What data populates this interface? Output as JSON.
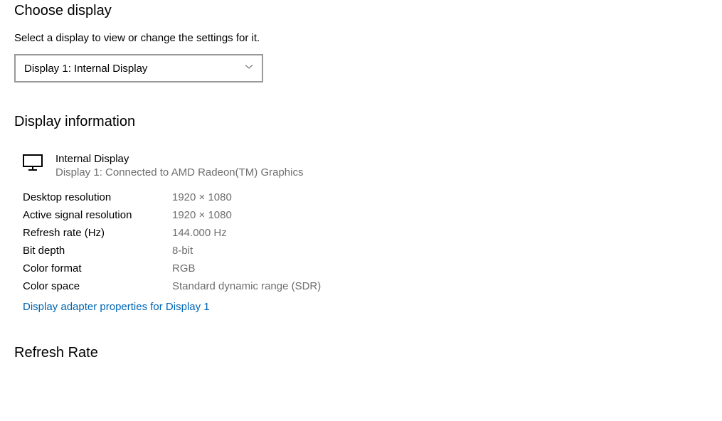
{
  "choose_display": {
    "heading": "Choose display",
    "subtext": "Select a display to view or change the settings for it.",
    "dropdown_value": "Display 1: Internal Display"
  },
  "display_information": {
    "heading": "Display information",
    "display_name": "Internal Display",
    "connected_text": "Display 1: Connected to AMD Radeon(TM) Graphics",
    "rows": [
      {
        "label": "Desktop resolution",
        "value": "1920 × 1080"
      },
      {
        "label": "Active signal resolution",
        "value": "1920 × 1080"
      },
      {
        "label": "Refresh rate (Hz)",
        "value": "144.000 Hz"
      },
      {
        "label": "Bit depth",
        "value": "8-bit"
      },
      {
        "label": "Color format",
        "value": "RGB"
      },
      {
        "label": "Color space",
        "value": "Standard dynamic range (SDR)"
      }
    ],
    "adapter_link": "Display adapter properties for Display 1"
  },
  "refresh_rate": {
    "heading": "Refresh Rate"
  }
}
